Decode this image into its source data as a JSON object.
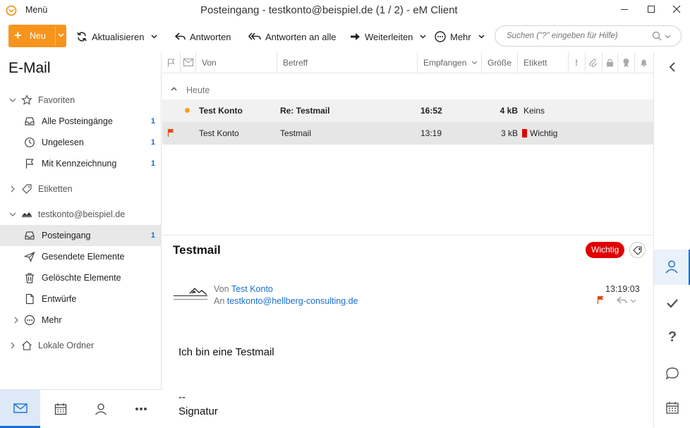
{
  "titlebar": {
    "menu_label": "Menü",
    "title": "Posteingang - testkonto@beispiel.de (1 / 2) - eM Client"
  },
  "toolbar": {
    "new_label": "Neu",
    "refresh_label": "Aktualisieren",
    "reply_label": "Antworten",
    "reply_all_label": "Antworten an alle",
    "forward_label": "Weiterleiten",
    "more_label": "Mehr",
    "search_placeholder": "Suchen (\"?\" eingeben für Hilfe)"
  },
  "sidebar": {
    "title": "E-Mail",
    "favorites_label": "Favoriten",
    "favorites": [
      {
        "label": "Alle Posteingänge",
        "count": "1"
      },
      {
        "label": "Ungelesen",
        "count": "1"
      },
      {
        "label": "Mit Kennzeichnung",
        "count": "1"
      }
    ],
    "tags_label": "Etiketten",
    "account_label": "testkonto@beispiel.de",
    "folders": [
      {
        "label": "Posteingang",
        "count": "1"
      },
      {
        "label": "Gesendete Elemente",
        "count": ""
      },
      {
        "label": "Gelöschte Elemente",
        "count": ""
      },
      {
        "label": "Entwürfe",
        "count": ""
      },
      {
        "label": "Mehr",
        "count": ""
      }
    ],
    "local_label": "Lokale Ordner"
  },
  "list": {
    "columns": {
      "from": "Von",
      "subject": "Betreff",
      "received": "Empfangen",
      "size": "Größe",
      "tag": "Etikett"
    },
    "group_label": "Heute",
    "rows": [
      {
        "from": "Test Konto",
        "subject": "Re: Testmail",
        "time": "16:52",
        "size": "4 kB",
        "tag": "Keins",
        "unread": true,
        "flag": false,
        "tag_color": ""
      },
      {
        "from": "Test Konto",
        "subject": "Testmail",
        "time": "13:19",
        "size": "3 kB",
        "tag": "Wichtig",
        "unread": false,
        "flag": true,
        "tag_color": "#e00000"
      }
    ]
  },
  "preview": {
    "subject": "Testmail",
    "tag_badge": "Wichtig",
    "from_prefix": "Von",
    "from_name": "Test Konto",
    "to_prefix": "An",
    "to_address": "testkonto@hellberg-consulting.de",
    "time": "13:19:03",
    "body_line1": "Ich bin eine Testmail",
    "sig_dash": "--",
    "sig_text": "Signatur"
  },
  "colors": {
    "accent": "#f7941d",
    "link": "#1a6fd0",
    "selected_row": "#e8e8e8",
    "badge_red": "#e00000"
  }
}
